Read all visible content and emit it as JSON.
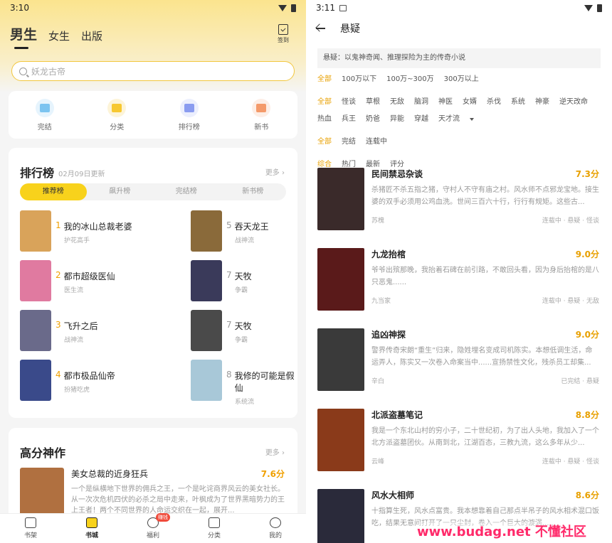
{
  "left": {
    "status_time": "3:10",
    "tabs": [
      "男生",
      "女生",
      "出版"
    ],
    "signin_label": "签到",
    "search_placeholder": "妖龙古帝",
    "shortcuts": [
      {
        "label": "完结",
        "color": "#7cc4f0"
      },
      {
        "label": "分类",
        "color": "#f7c830"
      },
      {
        "label": "排行榜",
        "color": "#8a9cf0"
      },
      {
        "label": "新书",
        "color": "#f49a6a"
      }
    ],
    "ranking": {
      "title": "排行榜",
      "updated": "02月09日更新",
      "more": "更多",
      "tabs": [
        "推荐榜",
        "飙升榜",
        "完结榜",
        "新书榜"
      ],
      "items": [
        {
          "rank": "1",
          "title": "我的冰山总裁老婆",
          "genre": "护花高手",
          "color": "#d9a35a"
        },
        {
          "rank": "2",
          "title": "都市超级医仙",
          "genre": "医生流",
          "color": "#e07aa0"
        },
        {
          "rank": "3",
          "title": "飞升之后",
          "genre": "战神流",
          "color": "#6a6a8a"
        },
        {
          "rank": "4",
          "title": "都市极品仙帝",
          "genre": "扮猪吃虎",
          "color": "#3a4a8a"
        },
        {
          "rank": "5",
          "title": "吞天龙王",
          "genre": "战神流",
          "color": "#8a6a3a"
        },
        {
          "rank": "7",
          "title": "天牧",
          "genre": "争霸",
          "color": "#3a3a5a"
        },
        {
          "rank": "7",
          "title": "天牧",
          "genre": "争霸",
          "color": "#4a4a4a"
        },
        {
          "rank": "8",
          "title": "我修的可能是假仙",
          "genre": "系统流",
          "color": "#a8c8d8"
        }
      ]
    },
    "high": {
      "title": "高分神作",
      "more": "更多",
      "book": {
        "title": "美女总裁的近身狂兵",
        "score": "7.6分",
        "desc": "一个是纵横地下世界的佣兵之王，一个是叱诧商界风云的美女社长。从一次次危机四伏的必杀之局中走来，叶枫成为了世界黑暗势力的王上王者！两个不同世界的人命运交织在一起，展开...",
        "color": "#b07040"
      }
    },
    "nav": [
      {
        "label": "书架"
      },
      {
        "label": "书城"
      },
      {
        "label": "福利",
        "badge": "赚钱"
      },
      {
        "label": "分类"
      },
      {
        "label": "我的"
      }
    ]
  },
  "right": {
    "status_time": "3:11",
    "title": "悬疑",
    "intro": "悬疑：以鬼神奇闻、推理探险为主的传奇小说",
    "filters": {
      "words": [
        "全部",
        "100万以下",
        "100万~300万",
        "300万以上"
      ],
      "tags": [
        "全部",
        "怪谈",
        "草根",
        "无敌",
        "脑洞",
        "神医",
        "女婿",
        "杀伐",
        "系统",
        "神豪",
        "逆天改命",
        "热血",
        "兵王",
        "奶爸",
        "异能",
        "穿越",
        "天才流"
      ],
      "status": [
        "全部",
        "完结",
        "连载中"
      ],
      "sort": [
        "综合",
        "热门",
        "最新",
        "评分"
      ]
    },
    "books": [
      {
        "title": "民间禁忌杂谈",
        "score": "7.3分",
        "desc": "杀猪匠不杀五指之猪，守村人不守有庙之村。风水师不点邪龙宝地。接生婆的双手必须用公鸡血洗。世间三百六十行，行行有规矩。这些古...",
        "author": "苏槐",
        "tags": "连载中 · 悬疑 · 怪谈",
        "color": "#3a2a2a"
      },
      {
        "title": "九龙抬棺",
        "score": "9.0分",
        "desc": "爷爷出殡那晚，我抬着石碑在前引路，不敢回头看，因为身后抬棺的是八只恶鬼......",
        "author": "九当家",
        "tags": "连载中 · 悬疑 · 无敌",
        "color": "#5a1a1a"
      },
      {
        "title": "追凶神探",
        "score": "9.0分",
        "desc": "警界传奇宋朗“重生”归来，隐姓埋名变成司机陈实。本想低调生活，命运弄人，陈实又一次卷入命案当中......宣扬禁性文化，残杀员工却集...",
        "author": "辛白",
        "tags": "已完结 · 悬疑",
        "color": "#3a3a3a"
      },
      {
        "title": "北派盗墓笔记",
        "score": "8.8分",
        "desc": "我是一个东北山村的穷小子，二十世纪初，为了出人头地，我加入了一个北方派盗墓团伙。从南到北，江湖百态，三教九流，这么多年从少...",
        "author": "云峰",
        "tags": "连载中 · 悬疑 · 怪谈",
        "color": "#8a3a1a"
      },
      {
        "title": "风水大相师",
        "score": "8.6分",
        "desc": "十指算生死，风水点富贵。我本想靠着自己那点半吊子的风水相术混口饭吃，结果无意间打开了一只尘封，卷入一个巨大的漩涡......",
        "author": "",
        "tags": "",
        "color": "#2a2a3a"
      }
    ]
  },
  "watermark": "www.budag.net 不懂社区"
}
